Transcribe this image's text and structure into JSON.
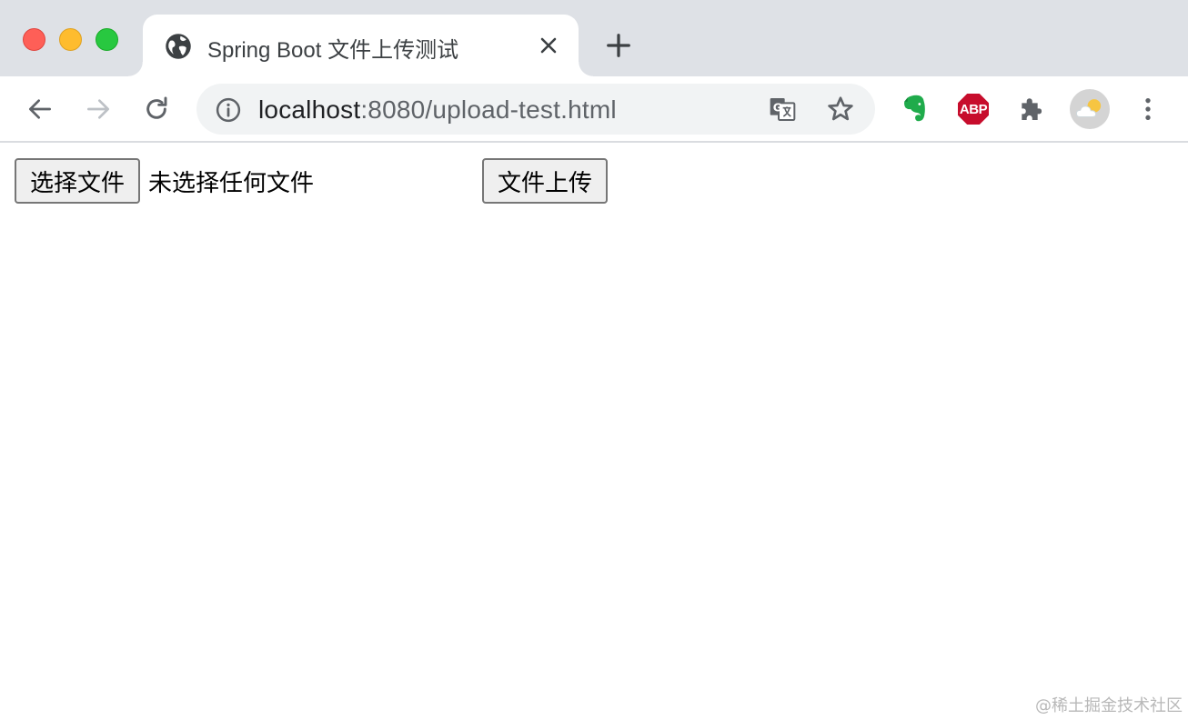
{
  "tab": {
    "title": "Spring Boot 文件上传测试"
  },
  "address_bar": {
    "host": "localhost",
    "rest": ":8080/upload-test.html"
  },
  "extensions": {
    "abp_label": "ABP"
  },
  "form": {
    "choose_file_label": "选择文件",
    "no_file_text": "未选择任何文件",
    "upload_label": "文件上传"
  },
  "watermark": "@稀土掘金技术社区",
  "colors": {
    "tabstrip": "#dee1e6",
    "close_red": "#fe5f57",
    "minimize_yellow": "#febc2e",
    "zoom_green": "#28c840",
    "evernote_green": "#1fab4b",
    "abp_red": "#c70d2c"
  }
}
